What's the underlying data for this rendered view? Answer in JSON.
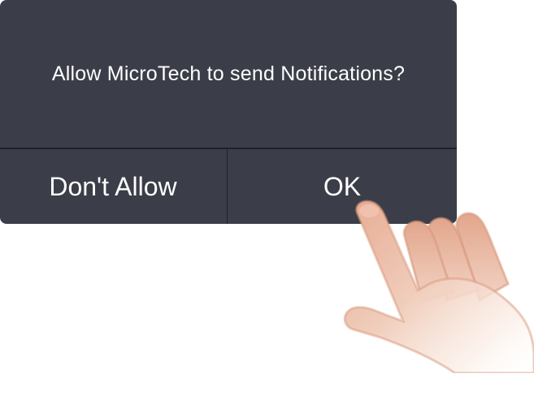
{
  "dialog": {
    "message": "Allow MicroTech to send Notifications?",
    "deny_label": "Don't Allow",
    "ok_label": "OK"
  },
  "colors": {
    "dialog_bg": "#3b3e48",
    "divider": "#1f2128",
    "text": "#ffffff",
    "skin": "#e8b49c"
  },
  "icons": {
    "pointer": "pointing-hand-icon"
  }
}
